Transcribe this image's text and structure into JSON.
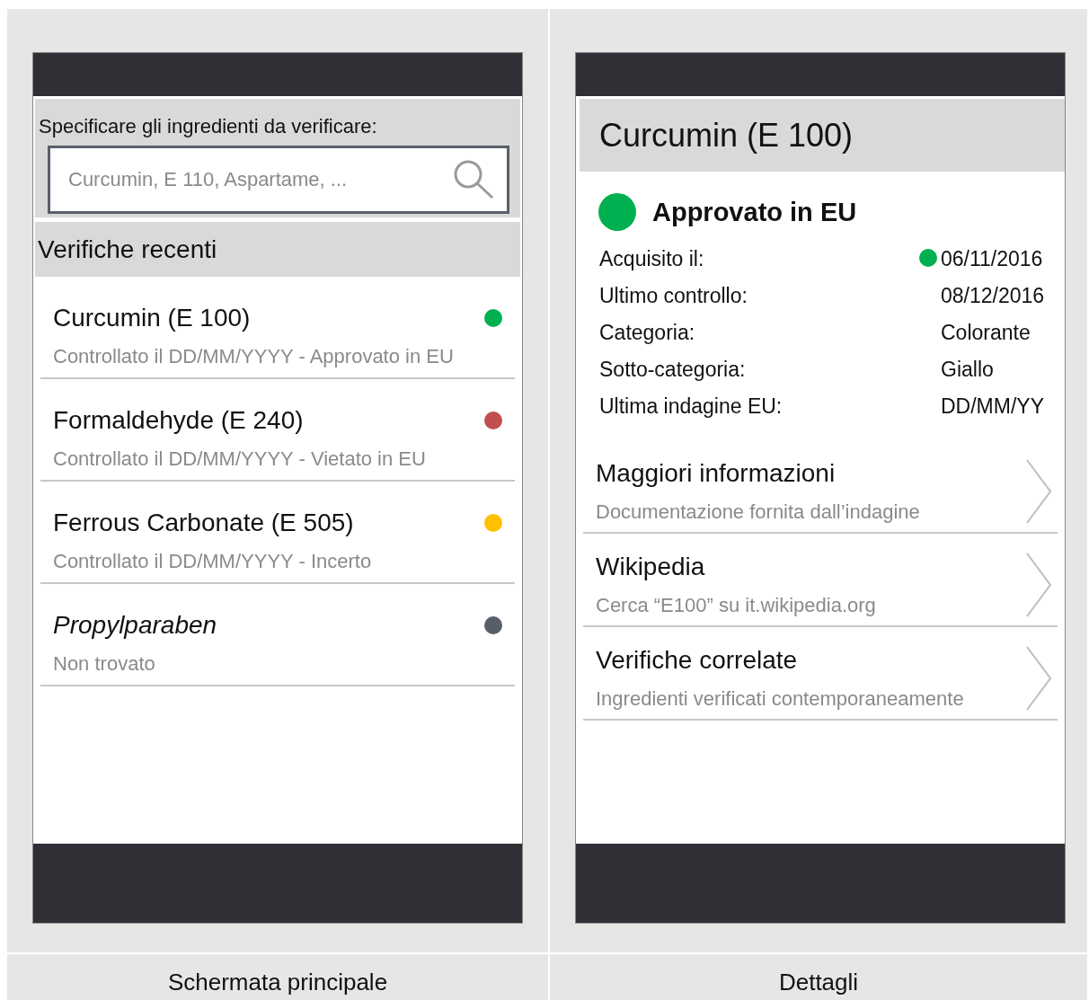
{
  "screens": [
    {
      "caption": "Schermata principale",
      "search": {
        "label": "Specificare gli ingredienti da verificare:",
        "placeholder": "Curcumin, E 110, Aspartame, ..."
      },
      "recent": {
        "title": "Verifiche recenti",
        "items": [
          {
            "name": "Curcumin (E 100)",
            "detail": "Controllato il DD/MM/YYYY - Approvato in EU",
            "color": "#00b050",
            "found": true
          },
          {
            "name": "Formaldehyde (E 240)",
            "detail": "Controllato il DD/MM/YYYY - Vietato in EU",
            "color": "#c0504d",
            "found": true
          },
          {
            "name": "Ferrous Carbonate (E 505)",
            "detail": "Controllato il DD/MM/YYYY - Incerto",
            "color": "#ffc000",
            "found": true
          },
          {
            "name": "Propylparaben",
            "detail": "Non trovato",
            "color": "#595d68",
            "found": false
          }
        ]
      }
    },
    {
      "caption": "Dettagli",
      "title": "Curcumin (E 100)",
      "status": {
        "label": "Approvato in EU",
        "color": "#00b050"
      },
      "facts": [
        {
          "label": "Acquisito il:",
          "value": "06/11/2016",
          "color": "#00b050"
        },
        {
          "label": "Ultimo controllo:",
          "value": "08/12/2016"
        },
        {
          "label": "Categoria:",
          "value": "Colorante"
        },
        {
          "label": "Sotto-categoria:",
          "value": "Giallo"
        },
        {
          "label": "Ultima indagine EU:",
          "value": "DD/MM/YY"
        }
      ],
      "links": [
        {
          "title": "Maggiori informazioni",
          "subtitle": "Documentazione fornita dall’indagine"
        },
        {
          "title": "Wikipedia",
          "subtitle": "Cerca “E100” su it.wikipedia.org"
        },
        {
          "title": "Verifiche correlate",
          "subtitle": "Ingredienti verificati contemporaneamente"
        }
      ]
    }
  ]
}
